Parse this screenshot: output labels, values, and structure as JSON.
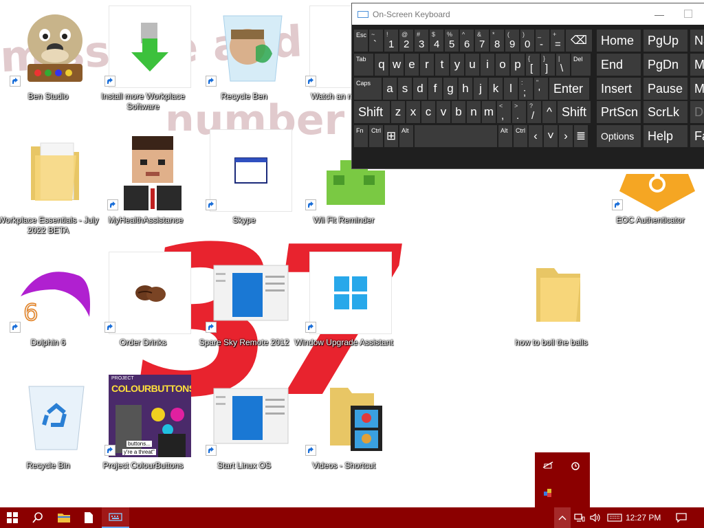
{
  "wallpaper": {
    "big_number": "37",
    "overlay_line1": "miss me and miss",
    "overlay_line2": "number"
  },
  "desktop_icons": [
    {
      "label": "Ben Studio"
    },
    {
      "label": "Install more Workplace Software"
    },
    {
      "label": "Recycle Ben"
    },
    {
      "label": "Watch an minutes"
    },
    {
      "label": "Workplace Essentials - July 2022 BETA"
    },
    {
      "label": "MyHealthAssistance"
    },
    {
      "label": "Skype"
    },
    {
      "label": "Wii Fit Reminder"
    },
    {
      "label": "EOC Authenticator"
    },
    {
      "label": "Dolphin 6"
    },
    {
      "label": "Order Drinks"
    },
    {
      "label": "Spare Sky Remote 2012"
    },
    {
      "label": "Window Upgrade Assistant"
    },
    {
      "label": "how to boil the balls"
    },
    {
      "label": "Recycle Bin"
    },
    {
      "label": "Project ColourButtons"
    },
    {
      "label": "Start Linux OS"
    },
    {
      "label": "Videos - Shortcut"
    }
  ],
  "thumb_text": {
    "colourbuttons_title": "COLOURBUTTONS",
    "colourbuttons_tag": "PROJECT",
    "colourbuttons_caption1": "buttons...",
    "colourbuttons_caption2": "y're a threat\""
  },
  "osk": {
    "title": "On-Screen Keyboard",
    "row1": [
      {
        "top": "Esc"
      },
      {
        "top": "~",
        "bottom": "`"
      },
      {
        "top": "!",
        "bottom": "1"
      },
      {
        "top": "@",
        "bottom": "2"
      },
      {
        "top": "#",
        "bottom": "3"
      },
      {
        "top": "$",
        "bottom": "4"
      },
      {
        "top": "%",
        "bottom": "5"
      },
      {
        "top": "^",
        "bottom": "6"
      },
      {
        "top": "&",
        "bottom": "7"
      },
      {
        "top": "*",
        "bottom": "8"
      },
      {
        "top": "(",
        "bottom": "9"
      },
      {
        "top": ")",
        "bottom": "0"
      },
      {
        "top": "_",
        "bottom": "-"
      },
      {
        "top": "+",
        "bottom": "="
      }
    ],
    "backspace": "⌫",
    "row2_tab": "Tab",
    "row2": [
      "q",
      "w",
      "e",
      "r",
      "t",
      "y",
      "u",
      "i",
      "o",
      "p"
    ],
    "row2_extra": [
      {
        "top": "{",
        "bottom": "["
      },
      {
        "top": "}",
        "bottom": "]"
      },
      {
        "top": "|",
        "bottom": "\\"
      }
    ],
    "del": "Del",
    "row3_caps": "Caps",
    "row3": [
      "a",
      "s",
      "d",
      "f",
      "g",
      "h",
      "j",
      "k",
      "l"
    ],
    "row3_extra": [
      {
        "top": ":",
        "bottom": ";"
      },
      {
        "top": "\"",
        "bottom": "'"
      }
    ],
    "enter": "Enter",
    "shift": "Shift",
    "row4": [
      "z",
      "x",
      "c",
      "v",
      "b",
      "n",
      "m"
    ],
    "row4_extra": [
      {
        "top": "<",
        "bottom": ","
      },
      {
        "top": ">",
        "bottom": "."
      },
      {
        "top": "?",
        "bottom": "/"
      }
    ],
    "up": "^",
    "fn": "Fn",
    "ctrl": "Ctrl",
    "alt": "Alt",
    "nav_keys": [
      "Home",
      "PgUp",
      "Na",
      "End",
      "PgDn",
      "Mv",
      "Insert",
      "Pause",
      "Mv",
      "PrtScn",
      "ScrLk",
      "De",
      "Options",
      "Help",
      "Fa"
    ]
  },
  "tray_popup": {
    "icons": [
      "network-off-icon",
      "alarm-icon",
      "color-app-icon"
    ]
  },
  "taskbar": {
    "clock": "12:27 PM",
    "icons": [
      "start",
      "search",
      "file-explorer",
      "notepad",
      "keyboard"
    ]
  },
  "colors": {
    "taskbar": "#8b0000",
    "osk_bg": "#1f1f1f",
    "osk_key": "#3b3b3b",
    "wallpaper_number": "#e8232e"
  }
}
